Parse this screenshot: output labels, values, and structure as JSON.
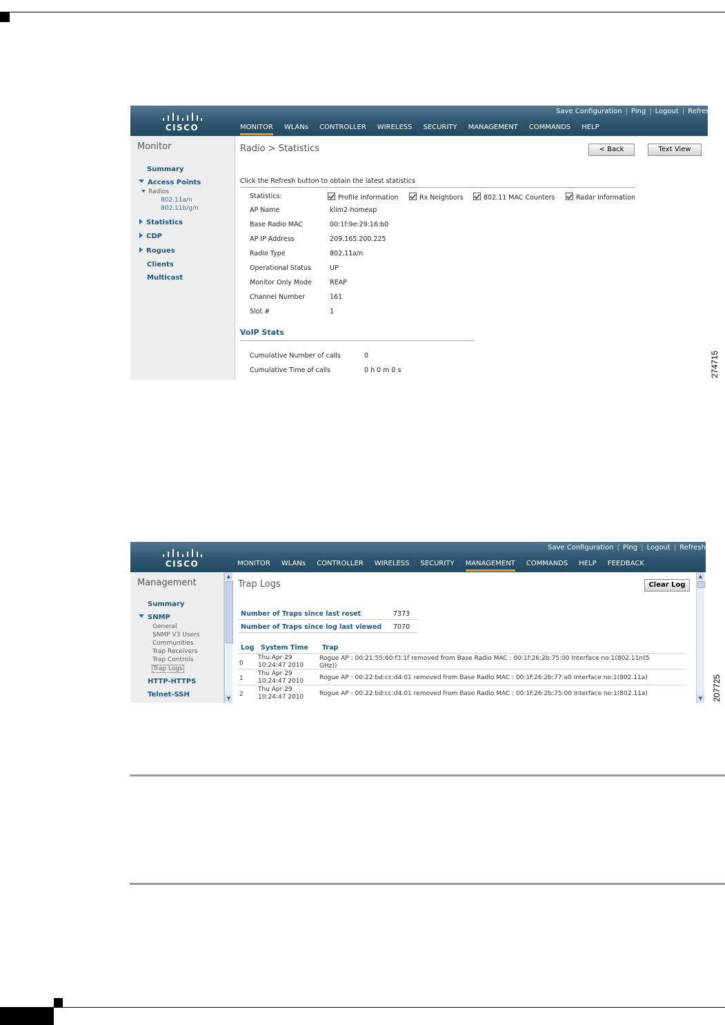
{
  "page": {
    "fig1_id": "274715",
    "fig2_id": "207725"
  },
  "shot1": {
    "top_links": [
      "Save Configuration",
      "Ping",
      "Logout",
      "Refres"
    ],
    "nav": [
      "MONITOR",
      "WLANs",
      "CONTROLLER",
      "WIRELESS",
      "SECURITY",
      "MANAGEMENT",
      "COMMANDS",
      "HELP"
    ],
    "active_nav": "MONITOR",
    "logo_text": "CISCO",
    "sidebar": {
      "title": "Monitor",
      "summary": "Summary",
      "access_points": "Access Points",
      "radios": "Radios",
      "radio_a": "802.11a/n",
      "radio_b": "802.11b/g/n",
      "statistics": "Statistics",
      "cdp": "CDP",
      "rogues": "Rogues",
      "clients": "Clients",
      "multicast": "Multicast"
    },
    "title": "Radio > Statistics",
    "back_button": "< Back",
    "text_view_button": "Text View",
    "instruction": "Click the Refresh button to obtain the latest statistics",
    "statistics_label": "Statistics:",
    "checkboxes": [
      "Profile Information",
      "Rx Neighbors",
      "802.11 MAC Counters",
      "Radar Information"
    ],
    "fields": [
      {
        "label": "AP Name",
        "value": "klim2-homeap"
      },
      {
        "label": "Base Radio MAC",
        "value": "00:1f:9e:29:16:b0"
      },
      {
        "label": "AP IP Address",
        "value": "209.165.200.225"
      },
      {
        "label": "Radio Type",
        "value": "802.11a/n"
      },
      {
        "label": "Operational Status",
        "value": "UP"
      },
      {
        "label": "Monitor Only Mode",
        "value": "REAP"
      },
      {
        "label": "Channel Number",
        "value": "161"
      },
      {
        "label": "Slot #",
        "value": "1"
      }
    ],
    "voip_title": "VoIP Stats",
    "voip_fields": [
      {
        "label": "Cumulative Number of calls",
        "value": "0"
      },
      {
        "label": "Cumulative Time of calls",
        "value": "0 h 0 m 0 s"
      }
    ]
  },
  "shot2": {
    "top_links": [
      "Save Configuration",
      "Ping",
      "Logout",
      "Refresh"
    ],
    "nav": [
      "MONITOR",
      "WLANs",
      "CONTROLLER",
      "WIRELESS",
      "SECURITY",
      "MANAGEMENT",
      "COMMANDS",
      "HELP",
      "FEEDBACK"
    ],
    "active_nav": "MANAGEMENT",
    "logo_text": "CISCO",
    "sidebar": {
      "title": "Management",
      "summary": "Summary",
      "snmp": "SNMP",
      "snmp_items": [
        "General",
        "SNMP V3 Users",
        "Communities",
        "Trap Receivers",
        "Trap Controls",
        "Trap Logs"
      ],
      "http": "HTTP-HTTPS",
      "telnet": "Telnet-SSH"
    },
    "title": "Trap Logs",
    "clear_button": "Clear Log",
    "counters": [
      {
        "label": "Number of Traps since last reset",
        "value": "7373"
      },
      {
        "label": "Number of Traps since log last viewed",
        "value": "7070"
      }
    ],
    "table_headers": [
      "Log",
      "System Time",
      "Trap"
    ],
    "rows": [
      {
        "log": "0",
        "time1": "Thu Apr 29",
        "time2": "10:24:47 2010",
        "trap1": "Rogue AP : 00:21:55:60:f3:1f removed from Base Radio MAC : 00:1f:26:2b:75:00 Interface no:1(802.11n(5",
        "trap2": "GHz))"
      },
      {
        "log": "1",
        "time1": "Thu Apr 29",
        "time2": "10:24:47 2010",
        "trap1": "Rogue AP : 00:22:bd:cc:d4:01 removed from Base Radio MAC : 00:1f:26:2b:77:a0 Interface no:1(802.11a)",
        "trap2": ""
      },
      {
        "log": "2",
        "time1": "Thu Apr 29",
        "time2": "10:24:47 2010",
        "trap1": "Rogue AP : 00:22:bd:cc:d4:01 removed from Base Radio MAC : 00:1f:26:2b:75:00 Interface no:1(802.11a)",
        "trap2": ""
      }
    ]
  },
  "colors": {
    "header_blue": "#2e556f",
    "nav_active": "#f7941d",
    "link_blue": "#1c5686"
  }
}
